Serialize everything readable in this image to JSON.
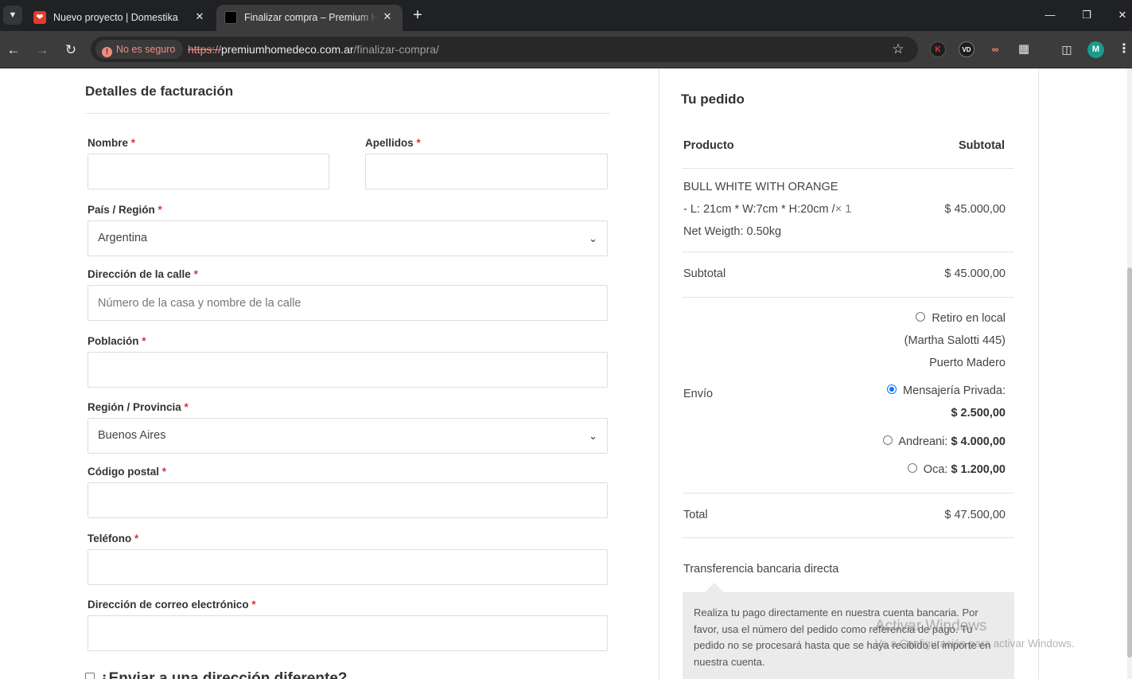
{
  "browser": {
    "tabs": [
      {
        "title": "Nuevo proyecto | Domestika",
        "active": false
      },
      {
        "title": "Finalizar compra – Premium Home Deco",
        "active": true
      }
    ],
    "security_label": "No es seguro",
    "url_scheme": "https://",
    "url_host": "premiumhomedeco.com.ar",
    "url_path": "/finalizar-compra/",
    "avatar_letter": "M",
    "ext_k": "K",
    "ext_vd": "VD"
  },
  "billing": {
    "title": "Detalles de facturación",
    "required_mark": "*",
    "nombre_label": "Nombre",
    "nombre_value": "",
    "apellidos_label": "Apellidos",
    "apellidos_value": "",
    "pais_label": "País / Región",
    "pais_value": "Argentina",
    "direccion_label": "Dirección de la calle",
    "direccion_placeholder": "Número de la casa y nombre de la calle",
    "poblacion_label": "Población",
    "region_label": "Región / Provincia",
    "region_value": "Buenos Aires",
    "cp_label": "Código postal",
    "telefono_label": "Teléfono",
    "email_label": "Dirección de correo electrónico",
    "ship_different": "¿Enviar a una dirección diferente?"
  },
  "order": {
    "title": "Tu pedido",
    "col_product": "Producto",
    "col_subtotal": "Subtotal",
    "item_line1": "BULL WHITE WITH ORANGE",
    "item_line2": "- L: 21cm * W:7cm * H:20cm /",
    "item_qty": "× 1",
    "item_line3": "Net Weigth: 0.50kg",
    "item_price": "$ 45.000,00",
    "subtotal_label": "Subtotal",
    "subtotal_value": "$ 45.000,00",
    "shipping_label": "Envío",
    "shipping_options": [
      {
        "name": "Retiro en local",
        "line2": "(Martha Salotti 445)",
        "line3": "Puerto Madero",
        "checked": false
      },
      {
        "name": "Mensajería Privada:",
        "price": "$ 2.500,00",
        "checked": true
      },
      {
        "name": "Andreani:",
        "price": "$ 4.000,00",
        "checked": false
      },
      {
        "name": "Oca:",
        "price": "$ 1.200,00",
        "checked": false
      }
    ],
    "total_label": "Total",
    "total_value": "$ 47.500,00",
    "payment_method": "Transferencia bancaria directa",
    "payment_description": "Realiza tu pago directamente en nuestra cuenta bancaria. Por favor, usa el número del pedido como referencia de pago. Tu pedido no se procesará hasta que se haya recibido el importe en nuestra cuenta."
  },
  "watermark": {
    "line1": "Activar Windows",
    "line2": "Ve a Configuración para activar Windows."
  }
}
